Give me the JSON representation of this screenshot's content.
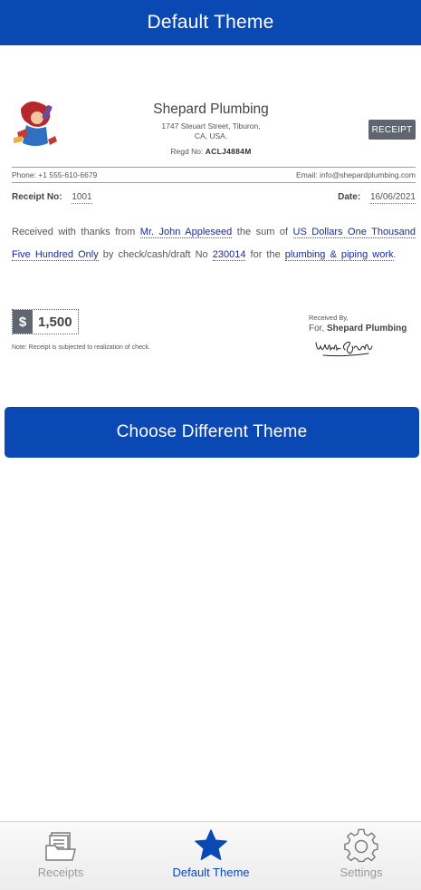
{
  "header": {
    "title": "Default Theme"
  },
  "receipt": {
    "company_name": "Shepard Plumbing",
    "address_line1": "1747 Steuart Street, Tiburon,",
    "address_line2": "CA, USA.",
    "regd_label": "Regd No:",
    "regd_value": "ACLJ4884M",
    "badge": "RECEIPT",
    "phone": "Phone: +1 555-610-6679",
    "email": "Email: info@shepardplumbing.com",
    "receipt_no_label": "Receipt No:",
    "receipt_no_value": "1001",
    "date_label": "Date:",
    "date_value": "16/06/2021",
    "text_received": "Received with thanks from",
    "payer": "Mr. John Appleseed",
    "text_sum": "the sum of",
    "amount_words": "US Dollars One Thousand Five Hundred Only",
    "text_by": "by check/cash/draft No",
    "check_no": "230014",
    "text_for": "for the",
    "purpose": "plumbing & piping work",
    "text_end": ".",
    "currency_symbol": "$",
    "amount": "1,500",
    "note": "Note: Receipt is subjected to realization of check.",
    "received_by": "Received By,",
    "for_label": "For,",
    "for_company": "Shepard Plumbing"
  },
  "actions": {
    "choose_theme": "Choose Different Theme"
  },
  "tabbar": {
    "tabs": [
      {
        "label": "Receipts",
        "icon": "receipts-icon",
        "active": false
      },
      {
        "label": "Default Theme",
        "icon": "star-icon",
        "active": true
      },
      {
        "label": "Settings",
        "icon": "gear-icon",
        "active": false
      }
    ]
  },
  "colors": {
    "primary": "#0a49b3",
    "badge": "#5f6670",
    "fill_text": "#1a2a9c"
  }
}
